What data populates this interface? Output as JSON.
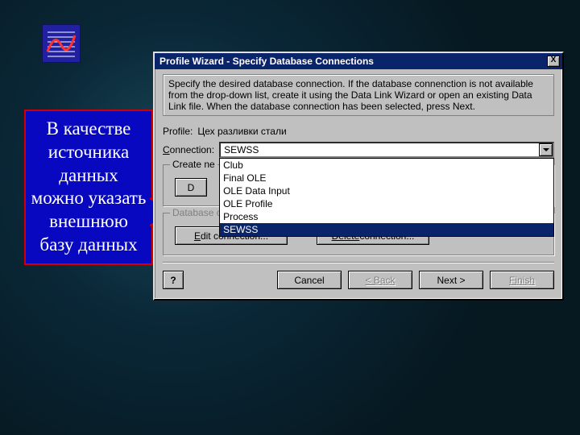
{
  "window": {
    "title": "Profile Wizard - Specify Database Connections",
    "instructions": "Specify the desired database connection.  If the database connenction is not available from the drop-down list, create it using the Data Link Wizard or open an existing Data Link file.  When the database connection has been selected, press Next.",
    "profile_label": "Profile:",
    "profile_value": "Цех разливки стали",
    "connection_label_prefix": "C",
    "connection_label_rest": "onnection:",
    "connection_value": "SEWSS",
    "options": [
      "Club",
      "Final OLE",
      "OLE Data Input",
      "OLE Profile",
      "Process",
      "SEWSS"
    ],
    "selected_option": "SEWSS",
    "group_create": "Create ne",
    "btn_d": "D",
    "group_manage": "Database connection management:",
    "btn_edit_prefix": "E",
    "btn_edit_rest": "dit connection...",
    "btn_delete_prefix": "Delete",
    "btn_delete_rest": " connection...",
    "btn_help": "?",
    "btn_cancel": "Cancel",
    "btn_back": "< Back",
    "btn_next": "Next >",
    "btn_finish": "Finish",
    "close_x": "X"
  },
  "callout_text": "В качестве источника данных можно указать внешнюю базу данных"
}
